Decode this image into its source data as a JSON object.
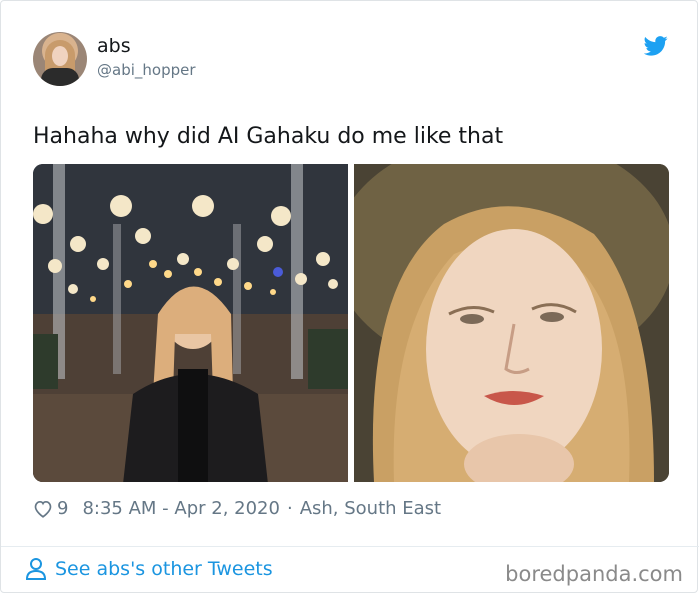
{
  "tweet": {
    "display_name": "abs",
    "handle": "@abi_hopper",
    "text": "Hahaha why did AI Gahaku do me like that",
    "like_count": "9",
    "timestamp": "8:35 AM - Apr 2, 2020",
    "location_sep": "·",
    "location": "Ash, South East"
  },
  "footer": {
    "see_more": "See abs's other Tweets"
  },
  "watermark": "boredpanda.com",
  "colors": {
    "twitter_blue": "#1da1f2",
    "link_blue": "#1b95e0",
    "muted_gray": "#657786"
  },
  "icons": {
    "brand": "twitter-bird-icon",
    "like": "heart-icon",
    "profile": "person-icon"
  }
}
